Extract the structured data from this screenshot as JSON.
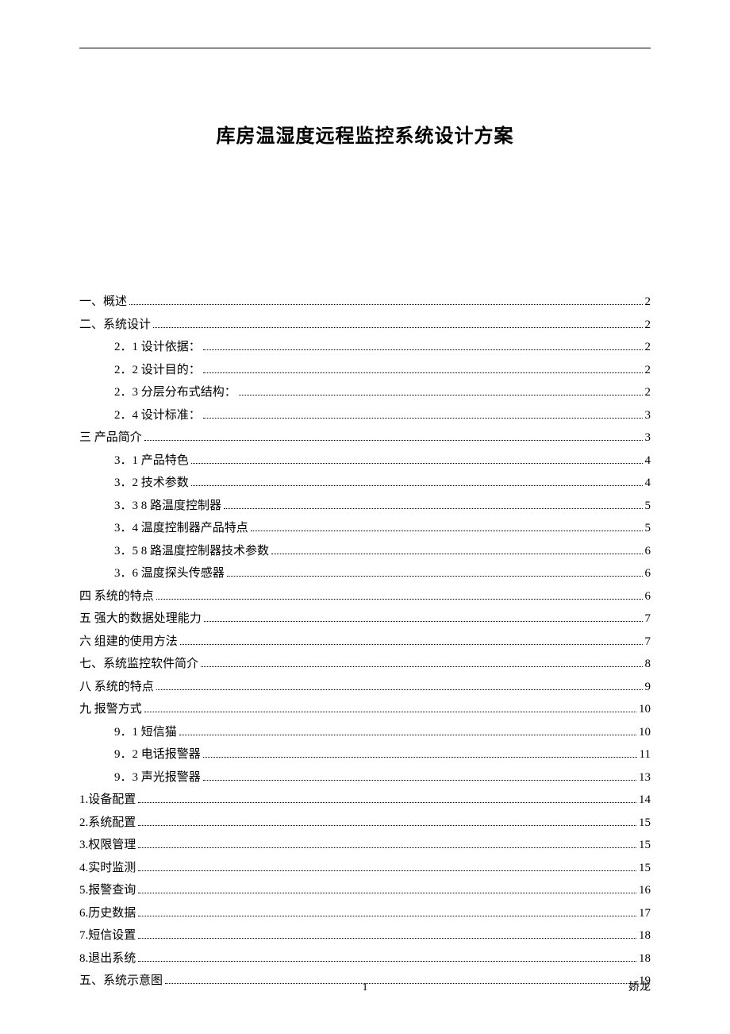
{
  "title": "库房温湿度远程监控系统设计方案",
  "toc": [
    {
      "level": 1,
      "label": "一、概述",
      "page": "2"
    },
    {
      "level": 1,
      "label": "二、系统设计",
      "page": "2"
    },
    {
      "level": 2,
      "label": "2．1 设计依据：",
      "page": "2"
    },
    {
      "level": 2,
      "label": "2．2 设计目的：",
      "page": "2"
    },
    {
      "level": 2,
      "label": "2．3 分层分布式结构：",
      "page": "2"
    },
    {
      "level": 2,
      "label": "2．4 设计标准：",
      "page": "3"
    },
    {
      "level": 1,
      "label": "三  产品简介",
      "page": "3"
    },
    {
      "level": 2,
      "label": "3．1 产品特色",
      "page": "4"
    },
    {
      "level": 2,
      "label": "3．2 技术参数",
      "page": "4"
    },
    {
      "level": 2,
      "label": "3．3  8 路温度控制器",
      "page": "5"
    },
    {
      "level": 2,
      "label": "3．4 温度控制器产品特点",
      "page": "5"
    },
    {
      "level": 2,
      "label": "3．5  8 路温度控制器技术参数",
      "page": "6"
    },
    {
      "level": 2,
      "label": "3．6  温度探头传感器",
      "page": "6"
    },
    {
      "level": 1,
      "label": "四   系统的特点",
      "page": "6"
    },
    {
      "level": 1,
      "label": "五   强大的数据处理能力",
      "page": "7"
    },
    {
      "level": 1,
      "label": "六   组建的使用方法",
      "page": "7"
    },
    {
      "level": 1,
      "label": "七、系统监控软件简介",
      "page": "8"
    },
    {
      "level": 1,
      "label": "八   系统的特点",
      "page": "9"
    },
    {
      "level": 1,
      "label": "九   报警方式",
      "page": "10"
    },
    {
      "level": 2,
      "label": "9．1  短信猫",
      "page": "10"
    },
    {
      "level": 2,
      "label": "9．2 电话报警器",
      "page": "11"
    },
    {
      "level": 2,
      "label": "9．3 声光报警器",
      "page": "13"
    },
    {
      "level": 1,
      "label": "1.设备配置",
      "page": "14"
    },
    {
      "level": 1,
      "label": "2.系统配置",
      "page": "15"
    },
    {
      "level": 1,
      "label": "3.权限管理",
      "page": "15"
    },
    {
      "level": 1,
      "label": "4.实时监测",
      "page": "15"
    },
    {
      "level": 1,
      "label": "5.报警查询",
      "page": "16"
    },
    {
      "level": 1,
      "label": "6.历史数据",
      "page": "17"
    },
    {
      "level": 1,
      "label": "7.短信设置",
      "page": "18"
    },
    {
      "level": 1,
      "label": "8.退出系统",
      "page": "18"
    },
    {
      "level": 1,
      "label": "五、系统示意图",
      "page": "19"
    }
  ],
  "footer": {
    "pagenum": "1",
    "author": "娇龙"
  }
}
